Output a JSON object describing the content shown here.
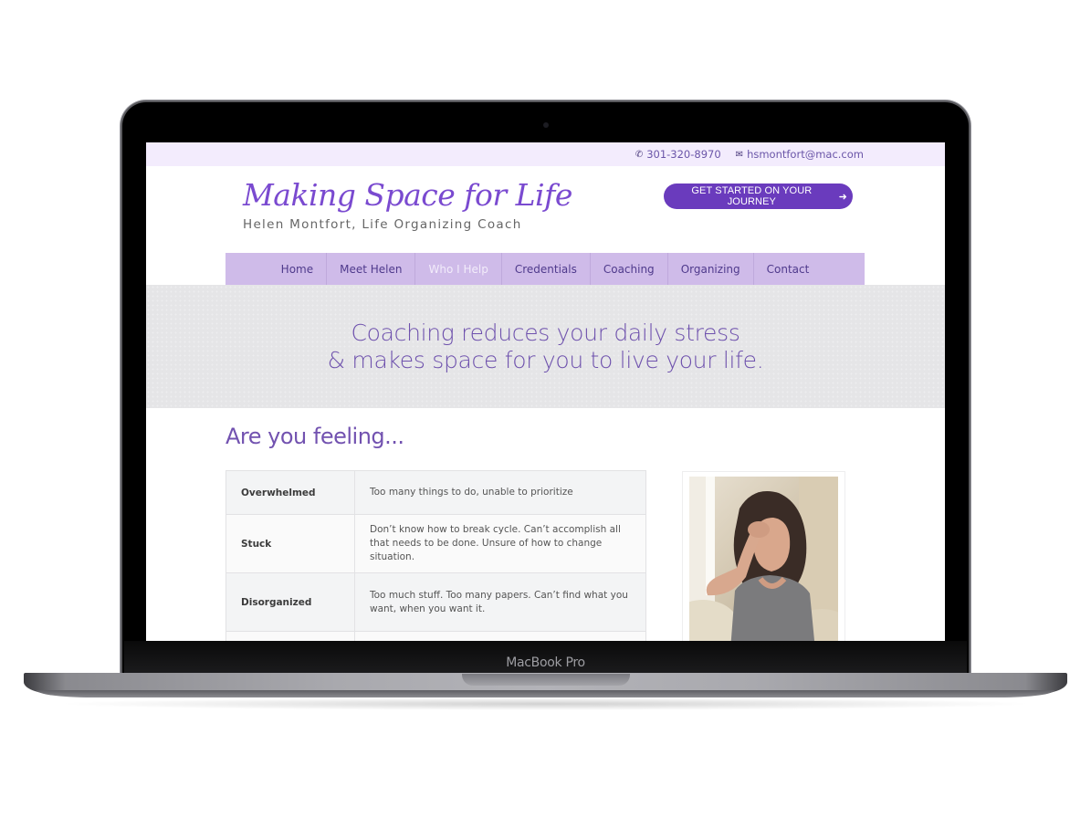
{
  "device": {
    "label": "MacBook Pro"
  },
  "site": {
    "topbar": {
      "phone_icon": "phone-icon",
      "phone": "301-320-8970",
      "email_icon": "envelope-icon",
      "email": "hsmontfort@mac.com"
    },
    "brand": {
      "title": "Making Space for Life",
      "subtitle": "Helen Montfort, Life Organizing Coach",
      "color": "#7a4ad0"
    },
    "cta": {
      "label": "GET STARTED ON YOUR JOURNEY",
      "icon": "arrow-right-icon",
      "arrow_glyph": "➜",
      "color": "#6a3bbd"
    },
    "nav": {
      "items": [
        {
          "label": "Home"
        },
        {
          "label": "Meet Helen"
        },
        {
          "label": "Who I Help",
          "active": true
        },
        {
          "label": "Credentials"
        },
        {
          "label": "Coaching"
        },
        {
          "label": "Organizing"
        },
        {
          "label": "Contact"
        }
      ],
      "color": "#cfbbe9"
    },
    "hero": {
      "line1": "Coaching reduces your daily stress",
      "line2": "& makes space for you to live your life."
    },
    "section": {
      "title": "Are you feeling..."
    },
    "feelings": [
      {
        "term": "Overwhelmed",
        "desc": "Too many things to do, unable to prioritize"
      },
      {
        "term": "Stuck",
        "desc": "Don’t know how to break cycle.  Can’t accomplish all that needs to be done. Unsure of how to change situation."
      },
      {
        "term": "Disorganized",
        "desc": "Too much stuff. Too many papers. Can’t find what you want, when you want it."
      },
      {
        "term": "",
        "desc": ""
      }
    ],
    "photo": {
      "alt": "Stressed woman holding her head"
    }
  }
}
